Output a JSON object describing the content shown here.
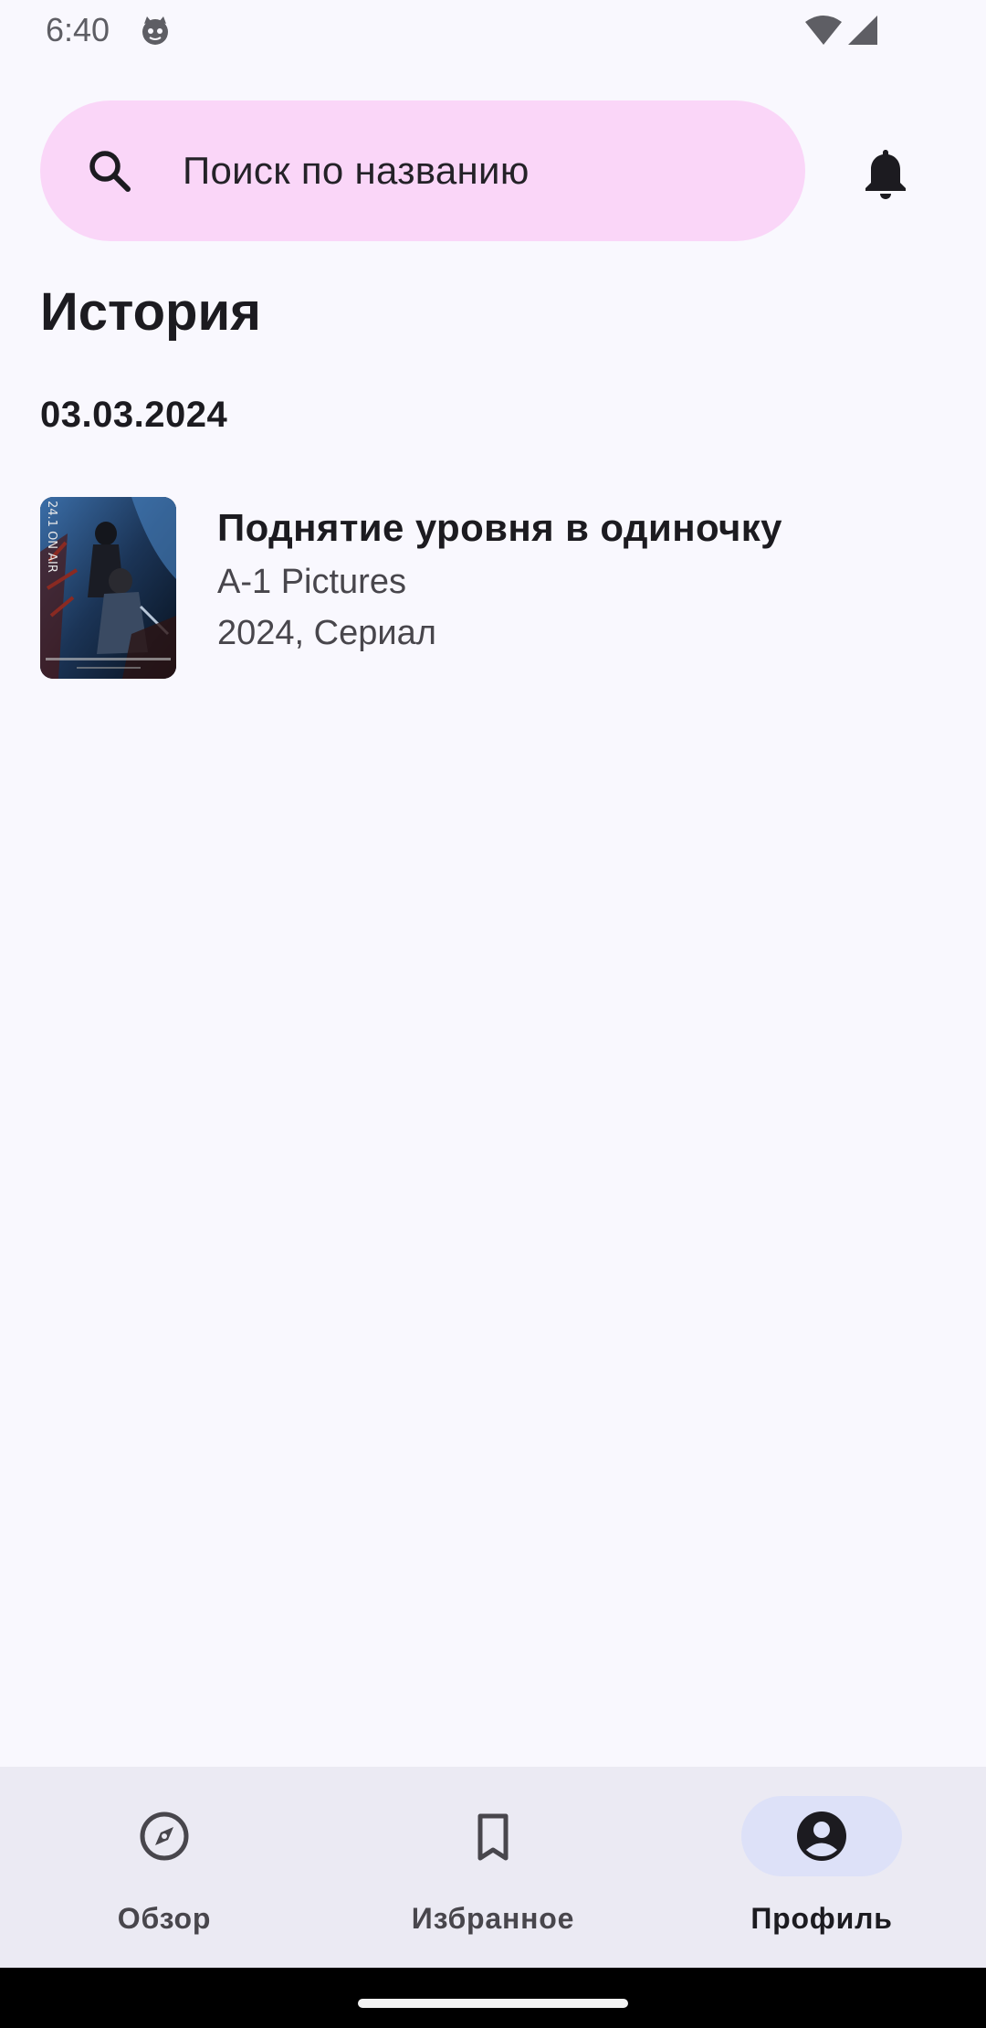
{
  "status_bar": {
    "time": "6:40",
    "icons": [
      "cat-face-icon",
      "wifi-icon",
      "cell-signal-icon"
    ]
  },
  "search": {
    "placeholder": "Поиск по названию"
  },
  "header": {
    "title": "История"
  },
  "history": {
    "groups": [
      {
        "date": "03.03.2024",
        "items": [
          {
            "title": "Поднятие уровня в одиночку",
            "studio": "A-1 Pictures",
            "meta": "2024, Сериал",
            "poster_text": "24.1 ON AIR"
          }
        ]
      }
    ]
  },
  "bottom_nav": {
    "items": [
      {
        "label": "Обзор",
        "icon": "compass-icon",
        "active": false
      },
      {
        "label": "Избранное",
        "icon": "bookmark-icon",
        "active": false
      },
      {
        "label": "Профиль",
        "icon": "account-circle-icon",
        "active": true
      }
    ]
  },
  "colors": {
    "background": "#f9f8fe",
    "search_bg": "#fad6f8",
    "nav_bg": "#ebeaf3",
    "nav_active_pill": "#dde1f8",
    "text_primary": "#1c1b20",
    "text_secondary": "#48464c"
  }
}
